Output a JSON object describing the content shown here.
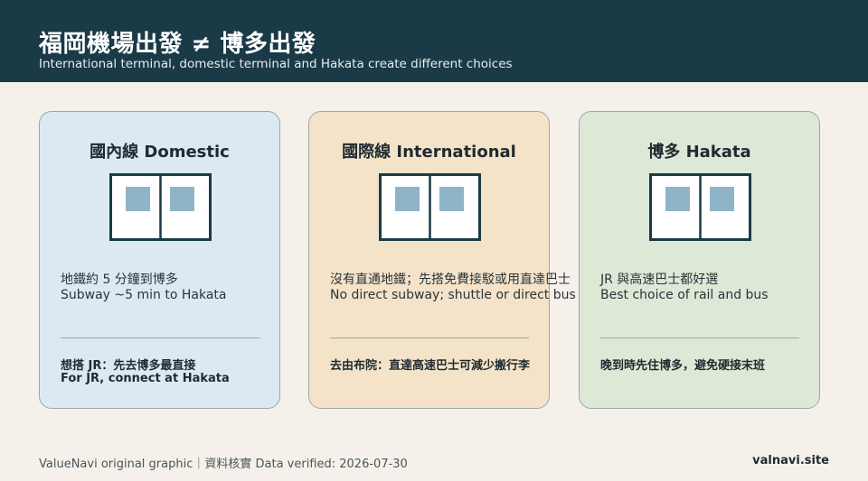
{
  "header": {
    "title": "福岡機場出發 ≠ 博多出發",
    "subtitle": "International terminal, domestic terminal and Hakata create different choices"
  },
  "cards": [
    {
      "title": "國內線 Domestic",
      "icon": "door-icon",
      "line1": "地鐵約 5 分鐘到博多",
      "line2": "Subway ~5 min to Hakata",
      "tip1": "想搭 JR：先去博多最直接",
      "tip2": "For JR, connect at Hakata"
    },
    {
      "title": "國際線 International",
      "icon": "door-icon",
      "line1": "沒有直通地鐵；先搭免費接駁或用直達巴士",
      "line2": "No direct subway; shuttle or direct bus",
      "tip1": "去由布院：直達高速巴士可減少搬行李",
      "tip2": ""
    },
    {
      "title": "博多 Hakata",
      "icon": "door-icon",
      "line1": "JR 與高速巴士都好選",
      "line2": "Best choice of rail and bus",
      "tip1": "晚到時先住博多，避免硬接末班",
      "tip2": ""
    }
  ],
  "footer": {
    "source": "ValueNavi original graphic｜資料核實 Data verified: 2026-07-30",
    "site": "valnavi.site"
  },
  "colors": {
    "header_bg": "#1a3a47",
    "page_bg": "#f5f1ea",
    "domestic_bg": "#dce8f2",
    "international_bg": "#f4e3c9",
    "hakata_bg": "#dde8d6",
    "window_blue": "#8fb4c8",
    "door_stroke": "#1a3a47"
  }
}
